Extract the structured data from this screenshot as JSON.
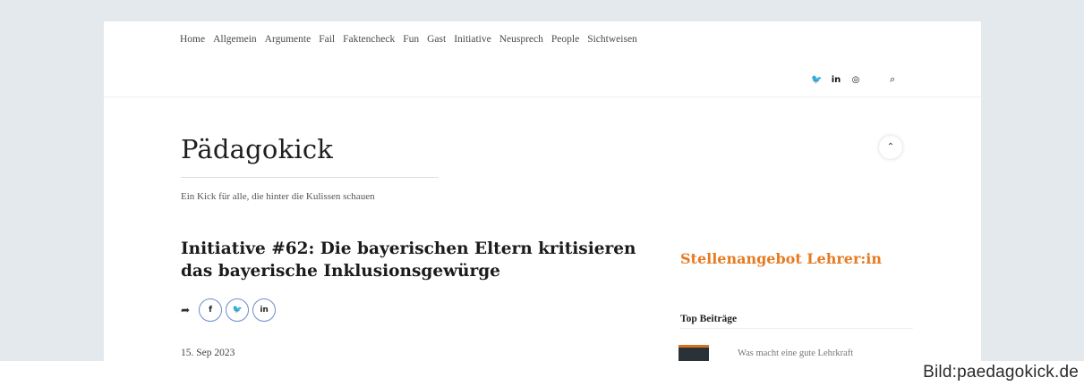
{
  "nav": {
    "items": [
      "Home",
      "Allgemein",
      "Argumente",
      "Fail",
      "Faktencheck",
      "Fun",
      "Gast",
      "Initiative",
      "Neusprech",
      "People",
      "Sichtweisen"
    ]
  },
  "social": {
    "icons": [
      "twitter-icon",
      "linkedin-icon",
      "instagram-icon"
    ],
    "twitter_glyph": "🐦",
    "linkedin_glyph": "in",
    "instagram_glyph": "◎",
    "search_glyph": "⌕"
  },
  "site": {
    "title": "Pädagokick",
    "tagline": "Ein Kick für alle, die hinter die Kulissen schauen",
    "toggle_glyph": "⌃"
  },
  "article": {
    "headline": "Initiative #62: Die bayerischen Eltern kritisieren das bayerische Inklusionsgewürge",
    "share_glyph": "➦",
    "share_buttons": [
      {
        "glyph": "f",
        "icon": "facebook-icon"
      },
      {
        "glyph": "🐦",
        "icon": "twitter-icon"
      },
      {
        "glyph": "in",
        "icon": "linkedin-icon"
      }
    ],
    "date": "15. Sep 2023"
  },
  "sidebar": {
    "promo": "Stellenangebot Lehrer:in",
    "top_title": "Top Beiträge",
    "top_item": "Was macht eine gute Lehrkraft"
  },
  "credit": "Bild:paedagokick.de",
  "colors": {
    "accent_orange": "#e77b22",
    "frame_bg": "#e4e9ee",
    "share_border": "#6d8bd1"
  }
}
